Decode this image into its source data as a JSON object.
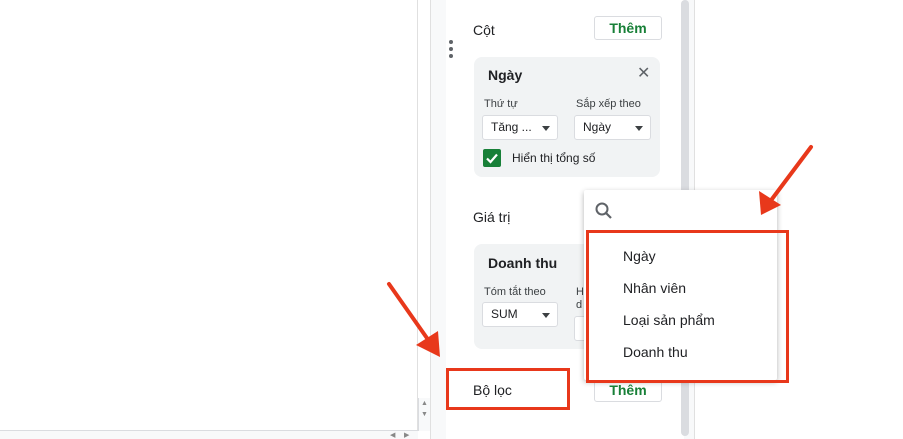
{
  "columns_section": {
    "title": "Cột",
    "add_label": "Thêm",
    "card": {
      "title": "Ngày",
      "order_label": "Thứ tự",
      "order_value": "Tăng ...",
      "sort_by_label": "Sắp xếp theo",
      "sort_by_value": "Ngày",
      "show_totals_label": "Hiển thị tổng số",
      "show_totals_checked": true
    }
  },
  "values_section": {
    "title": "Giá trị",
    "card": {
      "title": "Doanh thu",
      "summarize_label": "Tóm tắt theo",
      "summarize_value": "SUM",
      "partial_label_1": "H",
      "partial_label_2": "d"
    }
  },
  "filters_section": {
    "title": "Bộ lọc",
    "add_label": "Thêm"
  },
  "field_dropdown": {
    "search_placeholder": "",
    "options": [
      "Ngày",
      "Nhân viên",
      "Loại sản phẩm",
      "Doanh thu"
    ]
  },
  "colors": {
    "accent_green": "#188038",
    "highlight_red": "#e8381b"
  }
}
